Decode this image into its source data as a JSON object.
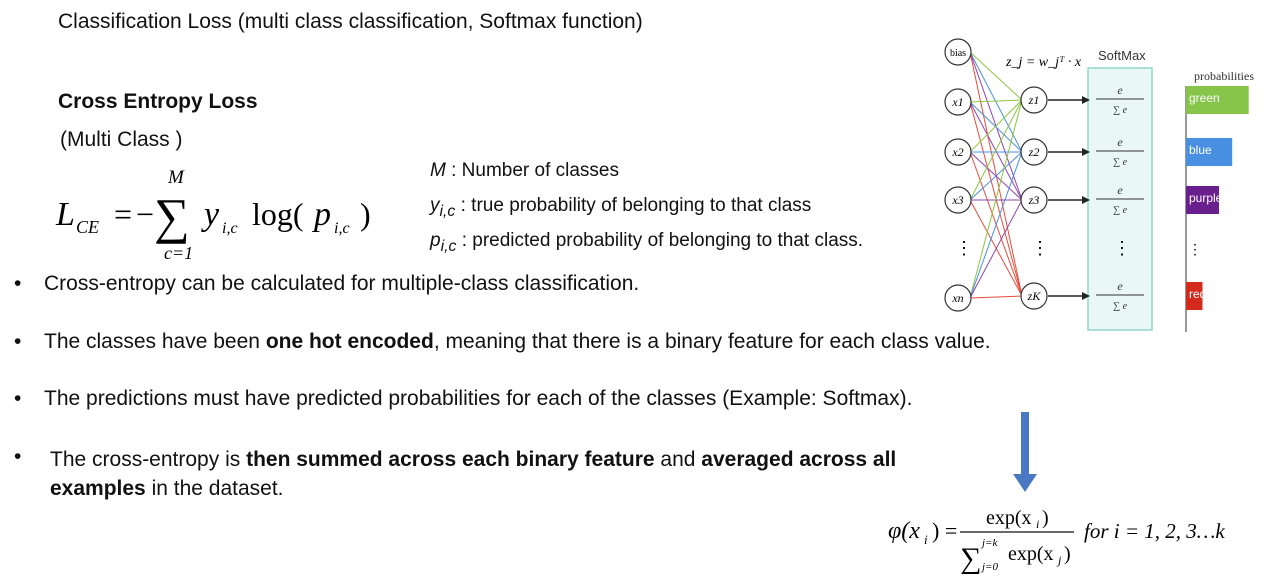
{
  "header": "Classification Loss (multi class classification, Softmax function)",
  "section_title": "Cross Entropy Loss",
  "section_subtitle": "(Multi Class )",
  "formula": {
    "lhs": "L",
    "lhs_sub": "CE",
    "sum_top": "M",
    "sum_bottom": "c=1",
    "y": "y",
    "y_sub": "i,c",
    "log": "log(",
    "p": "p",
    "p_sub": "i,c",
    "close": ")"
  },
  "legend": [
    {
      "sym": "M",
      "sub": "",
      "text": " : Number of classes"
    },
    {
      "sym": "y",
      "sub": "i,c",
      "text": " : true probability of belonging to that class"
    },
    {
      "sym": "p",
      "sub": "i,c",
      "text": " : predicted probability of belonging to that class."
    }
  ],
  "bullets": [
    {
      "segments": [
        {
          "t": "Cross-entropy can be calculated for multiple-class classification.",
          "b": false
        }
      ]
    },
    {
      "segments": [
        {
          "t": "The classes have been ",
          "b": false
        },
        {
          "t": "one hot encoded",
          "b": true
        },
        {
          "t": ", meaning that there is a binary feature for each class value.",
          "b": false
        }
      ]
    },
    {
      "segments": [
        {
          "t": "The predictions must have predicted probabilities for each of the classes (Example: Softmax).",
          "b": false
        }
      ]
    },
    {
      "segments": [
        {
          "t": "The cross-entropy is ",
          "b": false
        },
        {
          "t": "then summed across each binary feature",
          "b": true
        },
        {
          "t": " and ",
          "b": false
        },
        {
          "t": "averaged across all examples",
          "b": true
        },
        {
          "t": " in the dataset.",
          "b": false
        }
      ]
    }
  ],
  "diagram": {
    "inputs": [
      "bias",
      "x1",
      "x2",
      "x3",
      "⋮",
      "xn"
    ],
    "z_nodes": [
      "z1",
      "z2",
      "z3",
      "⋮",
      "zK"
    ],
    "z_eq": "z_j = w_jᵀ · x",
    "softmax_label": "SoftMax",
    "probabilities_label": "probabilities",
    "classes": [
      {
        "name": "green",
        "color": "#86c54a",
        "value": 0.95
      },
      {
        "name": "blue",
        "color": "#4a90e2",
        "value": 0.7
      },
      {
        "name": "purple",
        "color": "#6a1f8f",
        "value": 0.5
      },
      {
        "name": "red",
        "color": "#d42a1e",
        "value": 0.25
      }
    ],
    "edge_colors": [
      "#8cc63f",
      "#4a90e2",
      "#8e44ad",
      "#e74c3c"
    ]
  },
  "phi": {
    "lhs": "φ(x",
    "lhs_sub": "i",
    "lhs_close": ") =",
    "num": "exp(x",
    "num_sub": "i",
    "num_close": ")",
    "den_sum_top": "j=k",
    "den_sum_bottom": "j=0",
    "den": "exp(x",
    "den_sub": "j",
    "den_close": ")",
    "suffix": "for i = 1, 2, 3…k"
  }
}
